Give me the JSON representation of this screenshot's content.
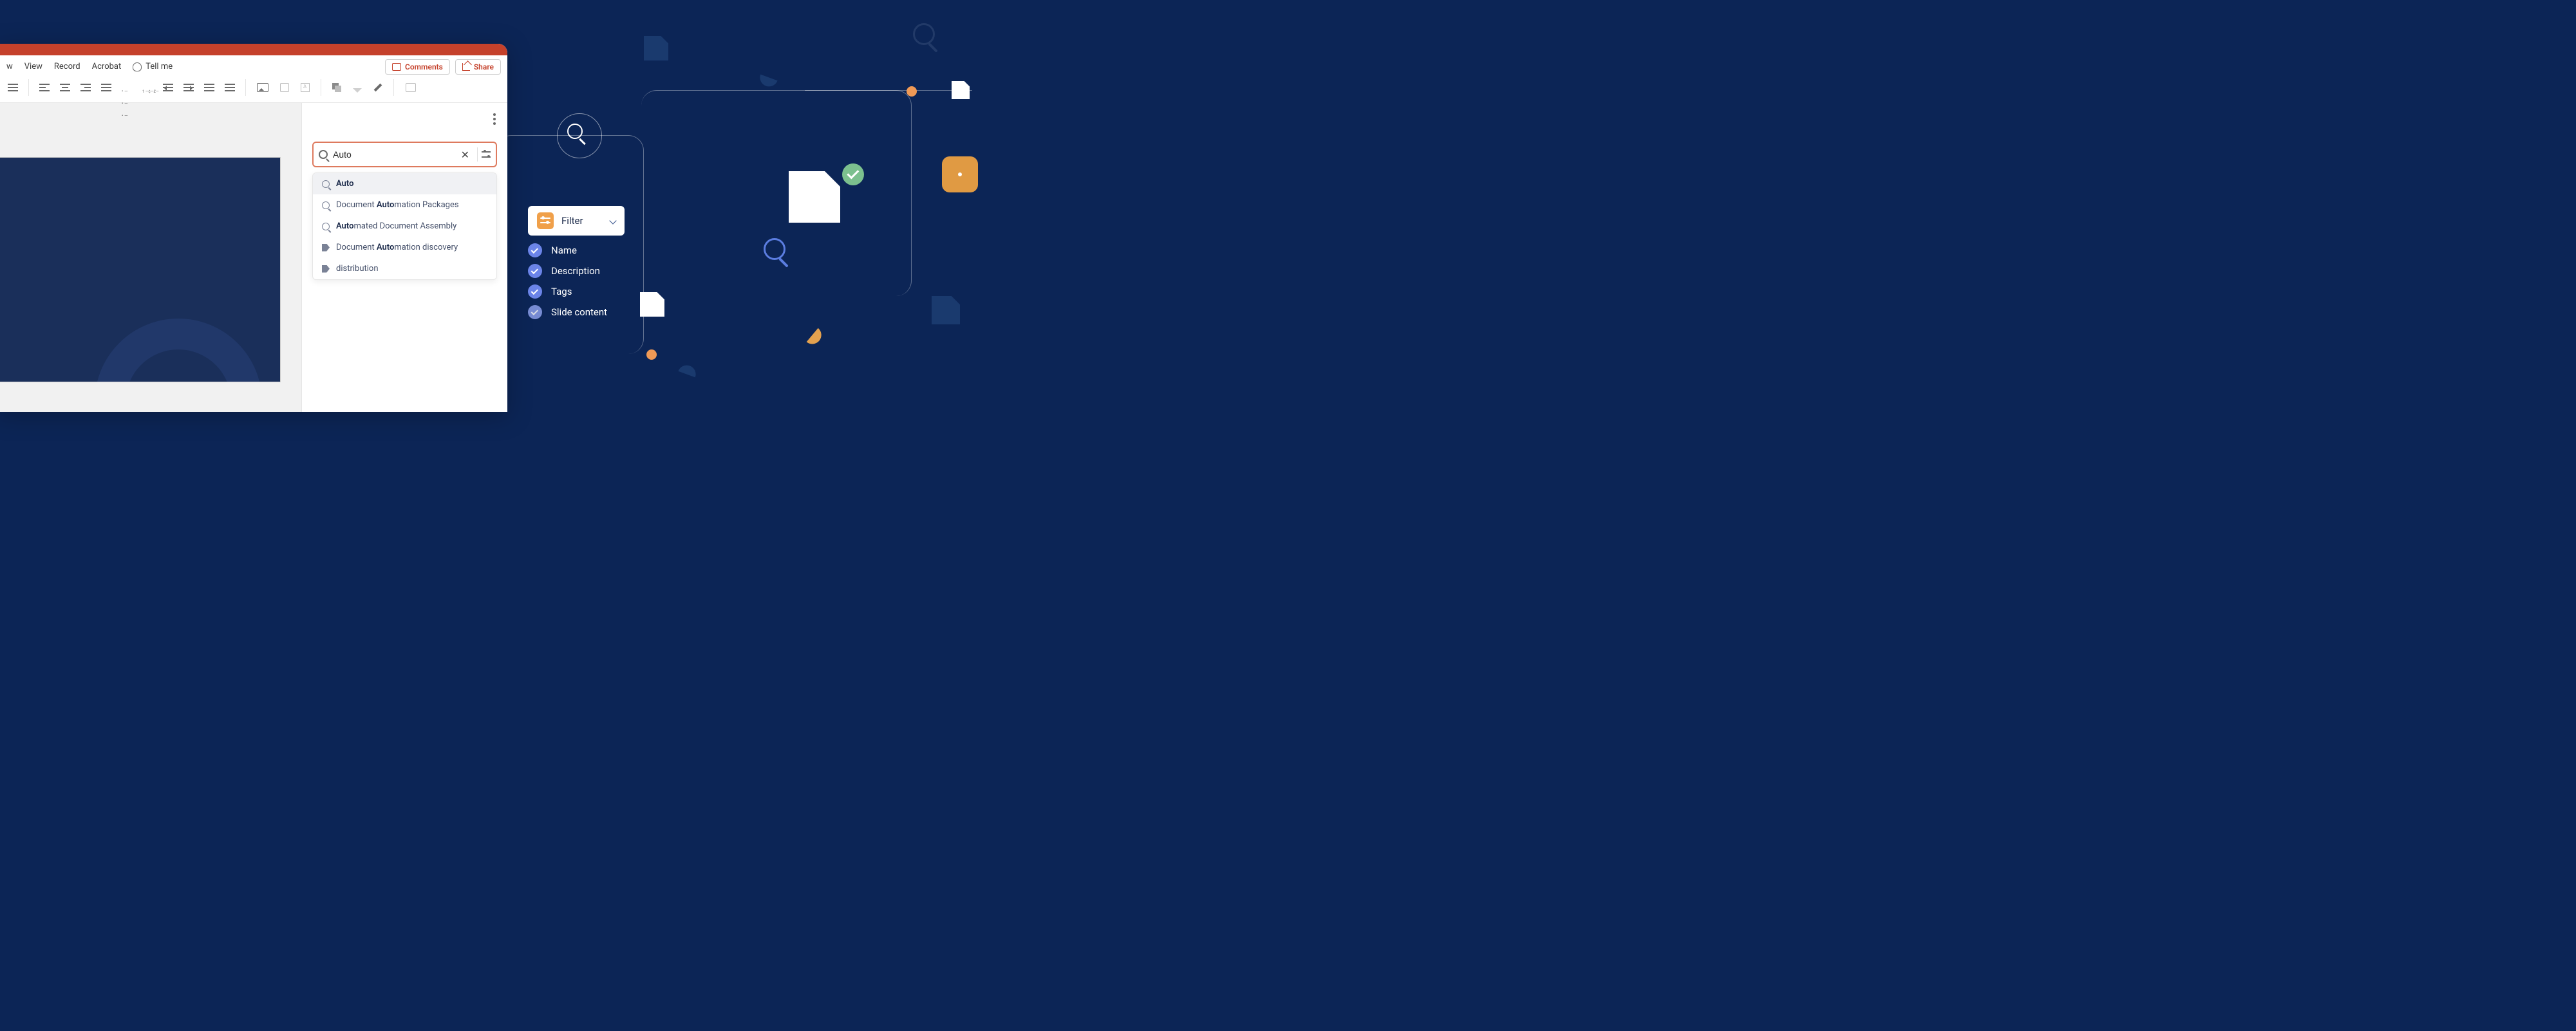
{
  "ribbon": {
    "tabs": [
      "w",
      "View",
      "Record",
      "Acrobat"
    ],
    "tellme": "Tell me",
    "comments": "Comments",
    "share": "Share"
  },
  "search": {
    "value": "Auto",
    "clear_glyph": "✕",
    "suggestions": [
      {
        "icon": "search",
        "pre": "",
        "bold": "Auto",
        "post": ""
      },
      {
        "icon": "search",
        "pre": "Document ",
        "bold": "Auto",
        "post": "mation Packages"
      },
      {
        "icon": "search",
        "pre": "",
        "bold": "Auto",
        "post": "mated Document Assembly"
      },
      {
        "icon": "tag",
        "pre": "Document ",
        "bold": "Auto",
        "post": "mation discovery"
      },
      {
        "icon": "tag",
        "pre": "distribution",
        "bold": "",
        "post": ""
      }
    ]
  },
  "filter": {
    "label": "Filter",
    "options": [
      "Name",
      "Description",
      "Tags",
      "Slide content"
    ]
  }
}
